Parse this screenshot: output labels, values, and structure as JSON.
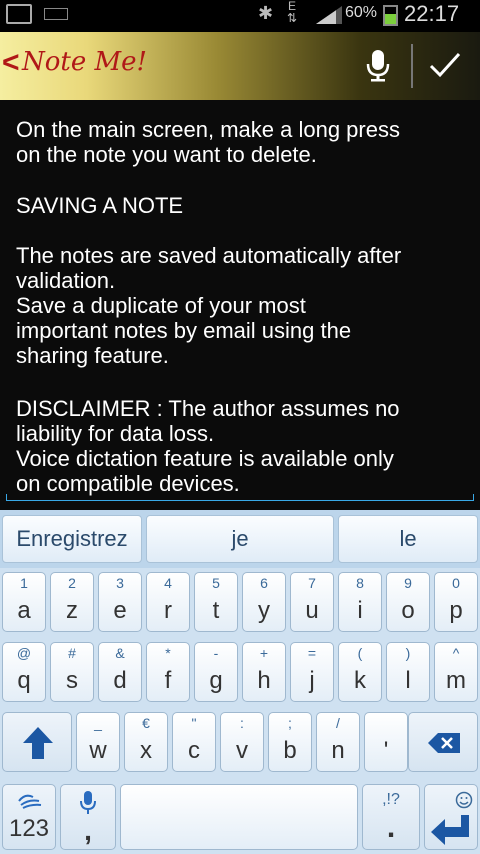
{
  "status_bar": {
    "bluetooth": "bluetooth-icon",
    "network_type": "E",
    "battery_percent": "60%",
    "battery_level": 0.6,
    "time": "22:17"
  },
  "header": {
    "back_glyph": "<",
    "title": "Note Me!",
    "mic_icon": "microphone-icon",
    "check_icon": "check-icon"
  },
  "note": {
    "paragraphs": [
      "On the main screen, make a long press\non the note you want to delete.",
      "SAVING A NOTE",
      "The notes are saved automatically after\nvalidation.\nSave a duplicate of your most\nimportant notes by email using the\nsharing feature.",
      "DISCLAIMER : The author assumes no\nliability for data loss.\nVoice dictation feature is available only\non compatible devices."
    ]
  },
  "keyboard": {
    "suggestions": [
      "Enregistrez",
      "je",
      "le"
    ],
    "row1": [
      {
        "top": "1",
        "main": "a"
      },
      {
        "top": "2",
        "main": "z"
      },
      {
        "top": "3",
        "main": "e"
      },
      {
        "top": "4",
        "main": "r"
      },
      {
        "top": "5",
        "main": "t"
      },
      {
        "top": "6",
        "main": "y"
      },
      {
        "top": "7",
        "main": "u"
      },
      {
        "top": "8",
        "main": "i"
      },
      {
        "top": "9",
        "main": "o"
      },
      {
        "top": "0",
        "main": "p"
      }
    ],
    "row2": [
      {
        "top": "@",
        "main": "q"
      },
      {
        "top": "#",
        "main": "s"
      },
      {
        "top": "&",
        "main": "d"
      },
      {
        "top": "*",
        "main": "f"
      },
      {
        "top": "-",
        "main": "g"
      },
      {
        "top": "+",
        "main": "h"
      },
      {
        "top": "=",
        "main": "j"
      },
      {
        "top": "(",
        "main": "k"
      },
      {
        "top": ")",
        "main": "l"
      },
      {
        "top": "^",
        "main": "m"
      }
    ],
    "row3": [
      {
        "top": "_",
        "main": "w"
      },
      {
        "top": "€",
        "main": "x"
      },
      {
        "top": "\"",
        "main": "c"
      },
      {
        "top": ":",
        "main": "v"
      },
      {
        "top": ";",
        "main": "b"
      },
      {
        "top": "/",
        "main": "n"
      },
      {
        "top": "",
        "main": "'"
      }
    ],
    "row4": {
      "num_label": "123",
      "comma": ",",
      "punct_top": ",!?",
      "period": ".",
      "swype_icon": "swype-icon",
      "mic_icon": "microphone-icon",
      "emoji_icon": "smiley-icon",
      "enter_icon": "enter-icon"
    },
    "shift_icon": "shift-icon",
    "backspace_icon": "backspace-icon"
  }
}
